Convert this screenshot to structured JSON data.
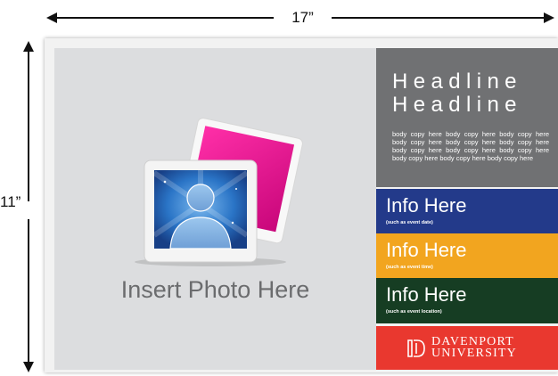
{
  "dimensions": {
    "width_label": "17”",
    "height_label": "11”"
  },
  "photo": {
    "caption": "Insert Photo Here"
  },
  "headline": {
    "line1": "Headline",
    "line2": "Headline"
  },
  "body_copy": "body copy here body copy here body copy here body copy here body copy here body copy here body copy here body copy here body copy here body copy here body copy here body copy here",
  "info_blocks": [
    {
      "title": "Info Here",
      "subtitle": "(such as event date)",
      "color": "#233a8a"
    },
    {
      "title": "Info Here",
      "subtitle": "(such as event time)",
      "color": "#f2a51f"
    },
    {
      "title": "Info Here",
      "subtitle": "(such as event location)",
      "color": "#163d23"
    }
  ],
  "brand": {
    "name_line1": "DAVENPORT",
    "name_line2": "UNIVERSITY",
    "color": "#e9382f"
  },
  "colors": {
    "headline_bg": "#707173",
    "photo_bg": "#dcdddf",
    "frame_pink": "#e8158a",
    "photo_blue": "#1f5fb0"
  }
}
